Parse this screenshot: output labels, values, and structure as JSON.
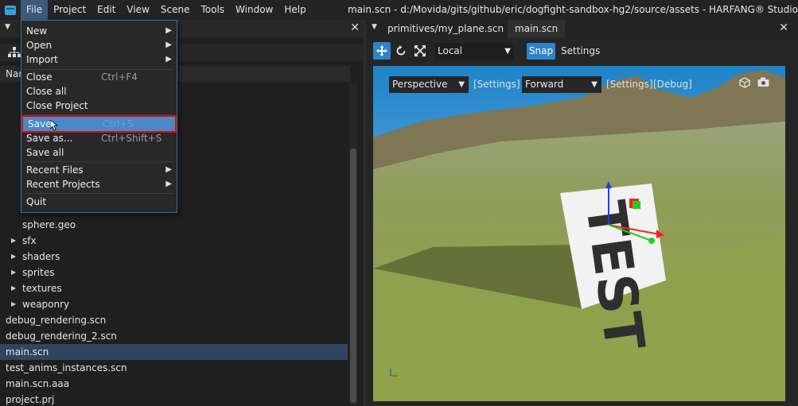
{
  "window_title": "main.scn - d:/Movida/gits/github/eric/dogfight-sandbox-hg2/source/assets - HARFANG® Studio",
  "menubar": {
    "items": [
      "File",
      "Project",
      "Edit",
      "View",
      "Scene",
      "Tools",
      "Window",
      "Help"
    ]
  },
  "file_menu": {
    "new": "New",
    "open": "Open",
    "import": "Import",
    "close": "Close",
    "close_shortcut": "Ctrl+F4",
    "close_all": "Close all",
    "close_project": "Close Project",
    "save": "Save",
    "save_shortcut": "Ctrl+S",
    "save_as": "Save as...",
    "save_as_shortcut": "Ctrl+Shift+S",
    "save_all": "Save all",
    "recent_files": "Recent Files",
    "recent_projects": "Recent Projects",
    "quit": "Quit"
  },
  "left_panel": {
    "column_header": "Nam",
    "tree": [
      {
        "label": "sphere.geo",
        "depth": 1,
        "folder": false
      },
      {
        "label": "sfx",
        "depth": 1,
        "folder": true
      },
      {
        "label": "shaders",
        "depth": 1,
        "folder": true
      },
      {
        "label": "sprites",
        "depth": 1,
        "folder": true
      },
      {
        "label": "textures",
        "depth": 1,
        "folder": true
      },
      {
        "label": "weaponry",
        "depth": 1,
        "folder": true
      },
      {
        "label": "debug_rendering.scn",
        "depth": 0,
        "folder": false
      },
      {
        "label": "debug_rendering_2.scn",
        "depth": 0,
        "folder": false
      },
      {
        "label": "main.scn",
        "depth": 0,
        "folder": false,
        "selected": true
      },
      {
        "label": "test_anims_instances.scn",
        "depth": 0,
        "folder": false
      },
      {
        "label": "main.scn.aaa",
        "depth": 0,
        "folder": false
      },
      {
        "label": "project.prj",
        "depth": 0,
        "folder": false
      }
    ]
  },
  "right_panel": {
    "tabs": [
      "primitives/my_plane.scn",
      "main.scn"
    ],
    "space_select": "Local",
    "snap": "Snap",
    "settings": "Settings"
  },
  "viewport": {
    "projection": "Perspective",
    "settings_link": "[Settings]",
    "pipeline": "Forward",
    "settings_link_2": "[Settings]",
    "debug_link": "[Debug]",
    "billboard_text": "TEST"
  },
  "colors": {
    "accent": "#2d84cc",
    "selection": "#31455e",
    "highlight_border": "#d01010"
  }
}
